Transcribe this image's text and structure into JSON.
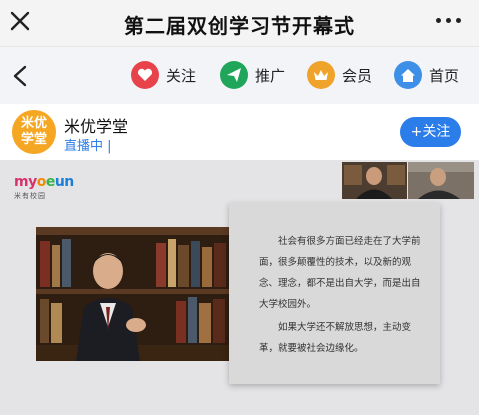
{
  "titlebar": {
    "title": "第二届双创学习节开幕式"
  },
  "nav": {
    "items": [
      {
        "label": "关注",
        "icon": "heart-icon",
        "color": "#e8434b"
      },
      {
        "label": "推广",
        "icon": "send-icon",
        "color": "#1fa65a"
      },
      {
        "label": "会员",
        "icon": "crown-icon",
        "color": "#f0a32a"
      },
      {
        "label": "首页",
        "icon": "home-icon",
        "color": "#3d8fe8"
      }
    ]
  },
  "account": {
    "avatar_text_line1": "米优",
    "avatar_text_line2": "学堂",
    "name": "米优学堂",
    "status": "直播中 |",
    "follow_label": "+关注"
  },
  "stage": {
    "logo_brand": "myoeun",
    "logo_sub": "米有校园",
    "paragraph1": "社会有很多方面已经走在了大学前面，很多颠覆性的技术，以及新的观念、理念，都不是出自大学，而是出自大学校园外。",
    "paragraph2": "如果大学还不解放思想，主动变革，就要被社会边缘化。"
  }
}
